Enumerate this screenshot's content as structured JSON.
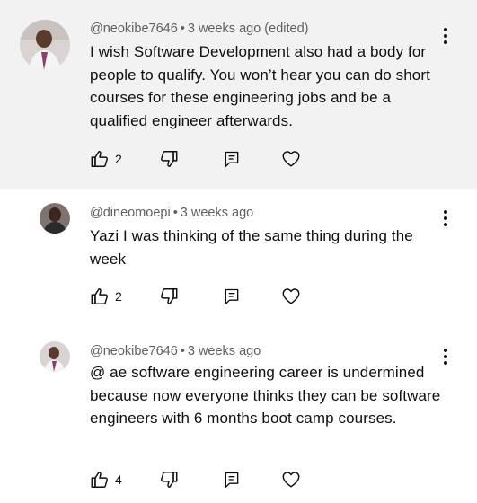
{
  "comments": [
    {
      "author": "@neokibe7646",
      "time": "3 weeks ago (edited)",
      "text": "I wish Software Development also had a body for people to qualify. You won’t hear you can do short courses for these engineering jobs and be a qualified engineer afterwards.",
      "likes": "2",
      "avatar_icon": "profile-photo-icon",
      "highlighted": true
    },
    {
      "author": "@dineomoepi",
      "time": "3 weeks ago",
      "text": "Yazi I was thinking of the same thing during the week",
      "likes": "2",
      "avatar_icon": "profile-photo-icon",
      "highlighted": false
    },
    {
      "author": "@neokibe7646",
      "time": "3 weeks ago",
      "text": "@ ae software engineering career is undermined because now everyone thinks they can be software engineers with 6 months boot camp courses.",
      "likes": "4",
      "avatar_icon": "profile-photo-icon",
      "highlighted": false
    }
  ],
  "icons": {
    "like": "thumbs-up-icon",
    "dislike": "thumbs-down-icon",
    "reply": "reply-icon",
    "heart": "heart-icon",
    "more": "more-vertical-icon"
  },
  "colors": {
    "highlight_bg": "#f2f2f2",
    "meta_text": "#606060",
    "body_text": "#0f0f0f"
  }
}
